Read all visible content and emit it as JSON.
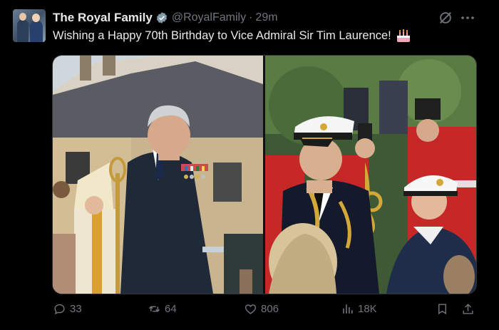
{
  "account": {
    "display_name": "The Royal Family",
    "handle": "@RoyalFamily",
    "separator": "·",
    "time_ago": "29m"
  },
  "tweet": {
    "text": "Wishing a Happy 70th Birthday to Vice Admiral Sir Tim Laurence!",
    "emoji": "birthday-cake-icon"
  },
  "actions": {
    "replies": "33",
    "reposts": "64",
    "likes": "806",
    "views": "18K"
  },
  "colors": {
    "background": "#000000",
    "text": "#e7e9ea",
    "muted": "#71767b",
    "verified": "#1d9bf0"
  },
  "icons": {
    "verified": "verified-badge-icon",
    "grok": "grok-icon",
    "more": "more-horizontal-icon",
    "reply": "reply-icon",
    "repost": "repost-icon",
    "like": "heart-icon",
    "views": "views-icon",
    "bookmark": "bookmark-icon",
    "share": "share-icon"
  }
}
